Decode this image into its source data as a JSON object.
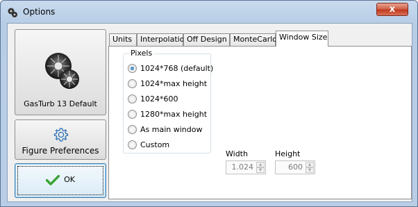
{
  "window": {
    "title": "Options",
    "close_glyph": "x"
  },
  "sidebar": {
    "preset_label": "GasTurb 13 Default",
    "preferences_label": "Figure Preferences",
    "ok_label": "OK"
  },
  "tabs": [
    {
      "label": "Units"
    },
    {
      "label": "Interpolation"
    },
    {
      "label": "Off Design"
    },
    {
      "label": "MonteCarlo"
    },
    {
      "label": "Window Size",
      "active": true
    }
  ],
  "window_size": {
    "group_label": "Pixels",
    "options": [
      {
        "label": "1024*768  (default)",
        "checked": true
      },
      {
        "label": "1024*max height",
        "checked": false
      },
      {
        "label": "1024*600",
        "checked": false
      },
      {
        "label": "1280*max height",
        "checked": false
      },
      {
        "label": "As main window",
        "checked": false
      },
      {
        "label": "Custom",
        "checked": false
      }
    ],
    "width_label": "Width",
    "width_value": "1.024",
    "height_label": "Height",
    "height_value": "600"
  },
  "colors": {
    "title_bar": "#c8daee",
    "close_button": "#c0391f",
    "ok_check": "#3aa335"
  },
  "icons": [
    "turbine-icon",
    "gear-icon",
    "check-icon",
    "close-icon"
  ]
}
